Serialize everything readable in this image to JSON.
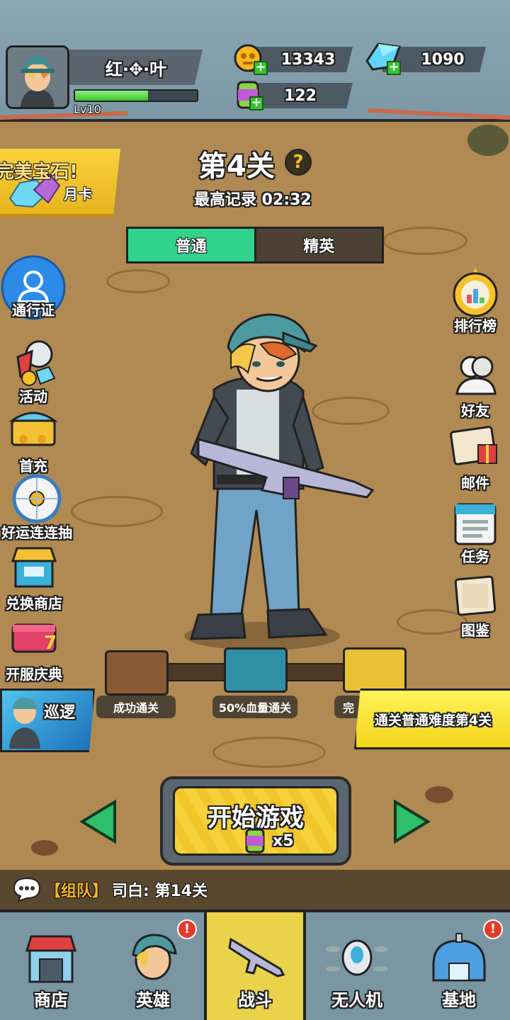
{
  "player": {
    "name": "红·✥·叶",
    "level": "Lv10",
    "xp_fraction": 0.6
  },
  "currencies": {
    "gold": "13343",
    "diamonds": "1090",
    "energy": "122"
  },
  "promo": {
    "headline": "完美宝石!",
    "sub": "月卡"
  },
  "stage": {
    "title": "第4关",
    "help": "?",
    "best_record": "最高记录 02:32",
    "tabs": [
      "普通",
      "精英"
    ],
    "selected_tab": "普通"
  },
  "left_menu": [
    {
      "label": "通行证",
      "icon": "person-icon"
    },
    {
      "label": "活动",
      "icon": "gift-cone-icon"
    },
    {
      "label": "首充",
      "icon": "treasure-chest-icon"
    },
    {
      "label": "好运连连抽",
      "icon": "wheel-icon"
    },
    {
      "label": "兑换商店",
      "icon": "shop-stall-icon"
    },
    {
      "label": "开服庆典",
      "icon": "celebration-box-icon"
    }
  ],
  "right_menu": [
    {
      "label": "排行榜",
      "icon": "trophy-icon"
    },
    {
      "label": "好友",
      "icon": "friends-icon"
    },
    {
      "label": "邮件",
      "icon": "mail-icon"
    },
    {
      "label": "任务",
      "icon": "task-calendar-icon"
    },
    {
      "label": "图鉴",
      "icon": "codex-icon"
    }
  ],
  "chests": [
    {
      "label": "成功通关",
      "color": "#8a5a34"
    },
    {
      "label": "50%血量通关",
      "color": "#2f8fa5"
    },
    {
      "label": "完",
      "color": "#e8c234"
    }
  ],
  "patrol": {
    "label": "巡逻"
  },
  "stage_goal": "通关普通难度第4关",
  "start": {
    "label": "开始游戏",
    "cost": "x5"
  },
  "chat": {
    "tag": "【组队】",
    "message": "司白: 第14关"
  },
  "nav": [
    {
      "label": "商店",
      "icon": "shop-icon",
      "badge": false
    },
    {
      "label": "英雄",
      "icon": "hero-icon",
      "badge": true
    },
    {
      "label": "战斗",
      "icon": "rifle-icon",
      "badge": false,
      "selected": true
    },
    {
      "label": "无人机",
      "icon": "drone-icon",
      "badge": false
    },
    {
      "label": "基地",
      "icon": "base-dome-icon",
      "badge": true
    }
  ],
  "badge_text": "!",
  "colors": {
    "accent_green": "#2fd389",
    "button_yellow": "#f6d23a",
    "chat_tag": "#f4b524"
  }
}
